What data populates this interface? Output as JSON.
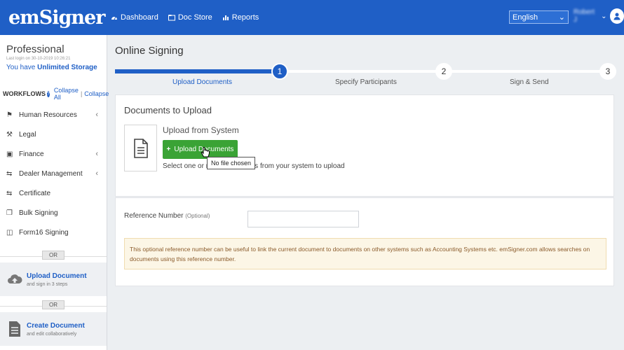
{
  "brand": {
    "logo_text": "emSigner"
  },
  "nav": {
    "dashboard": "Dashboard",
    "docstore": "Doc Store",
    "reports": "Reports"
  },
  "language": {
    "selected": "English"
  },
  "user": {
    "name": "Robert J"
  },
  "sidebar": {
    "plan": "Professional",
    "last_login": "Last login on 30-10-2019 10:26:21",
    "storage_prefix": "You have",
    "storage_value": "Unlimited Storage",
    "workflows_label": "WORKFLOWS",
    "collapse_all": "Collapse All",
    "collapse": "Collapse",
    "items": [
      {
        "label": "Human Resources",
        "icon": "people-icon",
        "has_children": true
      },
      {
        "label": "Legal",
        "icon": "gavel-icon",
        "has_children": false
      },
      {
        "label": "Finance",
        "icon": "briefcase-icon",
        "has_children": true
      },
      {
        "label": "Dealer Management",
        "icon": "retweet-icon",
        "has_children": true
      },
      {
        "label": "Certificate",
        "icon": "retweet-icon",
        "has_children": false
      },
      {
        "label": "Bulk Signing",
        "icon": "files-icon",
        "has_children": false
      },
      {
        "label": "Form16 Signing",
        "icon": "file-icon",
        "has_children": false
      }
    ],
    "or_label": "OR",
    "upload_doc": {
      "title": "Upload Document",
      "sub": "and sign in 3 steps"
    },
    "create_doc": {
      "title": "Create Document",
      "sub": "and edit collaboratively"
    }
  },
  "main": {
    "page_title": "Online Signing",
    "steps": [
      {
        "num": "1",
        "label": "Upload Documents",
        "active": true
      },
      {
        "num": "2",
        "label": "Specify Participants",
        "active": false
      },
      {
        "num": "3",
        "label": "Sign & Send",
        "active": false
      }
    ],
    "docs_title": "Documents to Upload",
    "upload_title": "Upload from System",
    "upload_button": "Upload Documents",
    "tooltip": "No file chosen",
    "upload_hint": "Select one or more documents from your system to upload",
    "ref_label": "Reference Number",
    "ref_optional": "(Optional)",
    "ref_value": "",
    "notice": "This optional reference number can be useful to link the current document to documents on other systems such as Accounting Systems etc. emSigner.com allows searches on documents using this reference number."
  },
  "colors": {
    "primary": "#1f5fc6",
    "success": "#3aa335",
    "notice_bg": "#fcf6e6"
  }
}
